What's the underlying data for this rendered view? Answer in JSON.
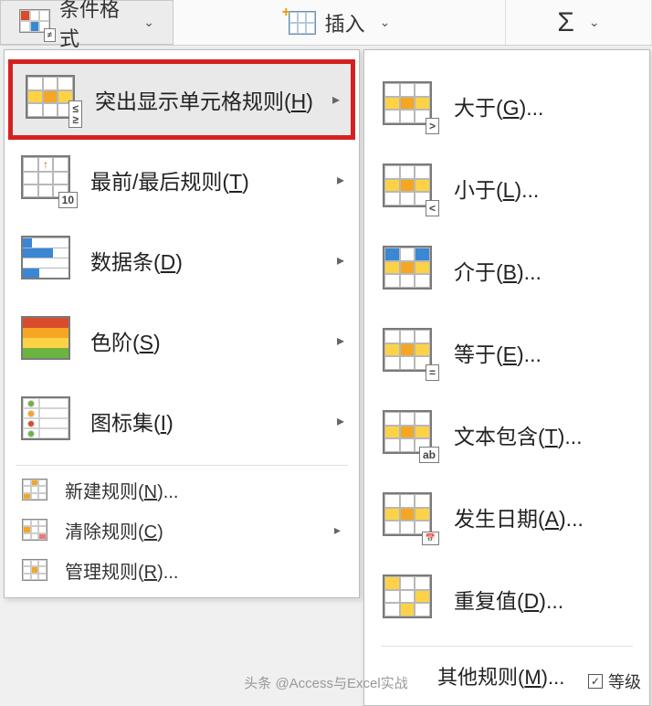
{
  "toolbar": {
    "cond_format": "条件格式",
    "insert": "插入",
    "autosum": "Σ"
  },
  "menu": {
    "highlight": {
      "label": "突出显示单元格规则(",
      "hotkey": "H",
      "tail": ")"
    },
    "toprules": {
      "label": "最前/最后规则(",
      "hotkey": "T",
      "tail": ")"
    },
    "databars": {
      "label": "数据条(",
      "hotkey": "D",
      "tail": ")"
    },
    "colorscale": {
      "label": "色阶(",
      "hotkey": "S",
      "tail": ")"
    },
    "iconsets": {
      "label": "图标集(",
      "hotkey": "I",
      "tail": ")"
    },
    "newrule": {
      "label": "新建规则(",
      "hotkey": "N",
      "tail": ")..."
    },
    "clear": {
      "label": "清除规则(",
      "hotkey": "C",
      "tail": ")"
    },
    "manage": {
      "label": "管理规则(",
      "hotkey": "R",
      "tail": ")..."
    }
  },
  "submenu": {
    "gt": {
      "label": "大于(",
      "hotkey": "G",
      "tail": ")..."
    },
    "lt": {
      "label": "小于(",
      "hotkey": "L",
      "tail": ")..."
    },
    "between": {
      "label": "介于(",
      "hotkey": "B",
      "tail": ")..."
    },
    "equal": {
      "label": "等于(",
      "hotkey": "E",
      "tail": ")..."
    },
    "textcont": {
      "label": "文本包含(",
      "hotkey": "T",
      "tail": ")..."
    },
    "date": {
      "label": "发生日期(",
      "hotkey": "A",
      "tail": ")..."
    },
    "dup": {
      "label": "重复值(",
      "hotkey": "D",
      "tail": ")..."
    },
    "more": {
      "label": "其他规则(",
      "hotkey": "M",
      "tail": ")..."
    }
  },
  "footer": {
    "watermark": "头条 @Access与Excel实战",
    "checkbox_label": "等级",
    "checked": "✓"
  }
}
